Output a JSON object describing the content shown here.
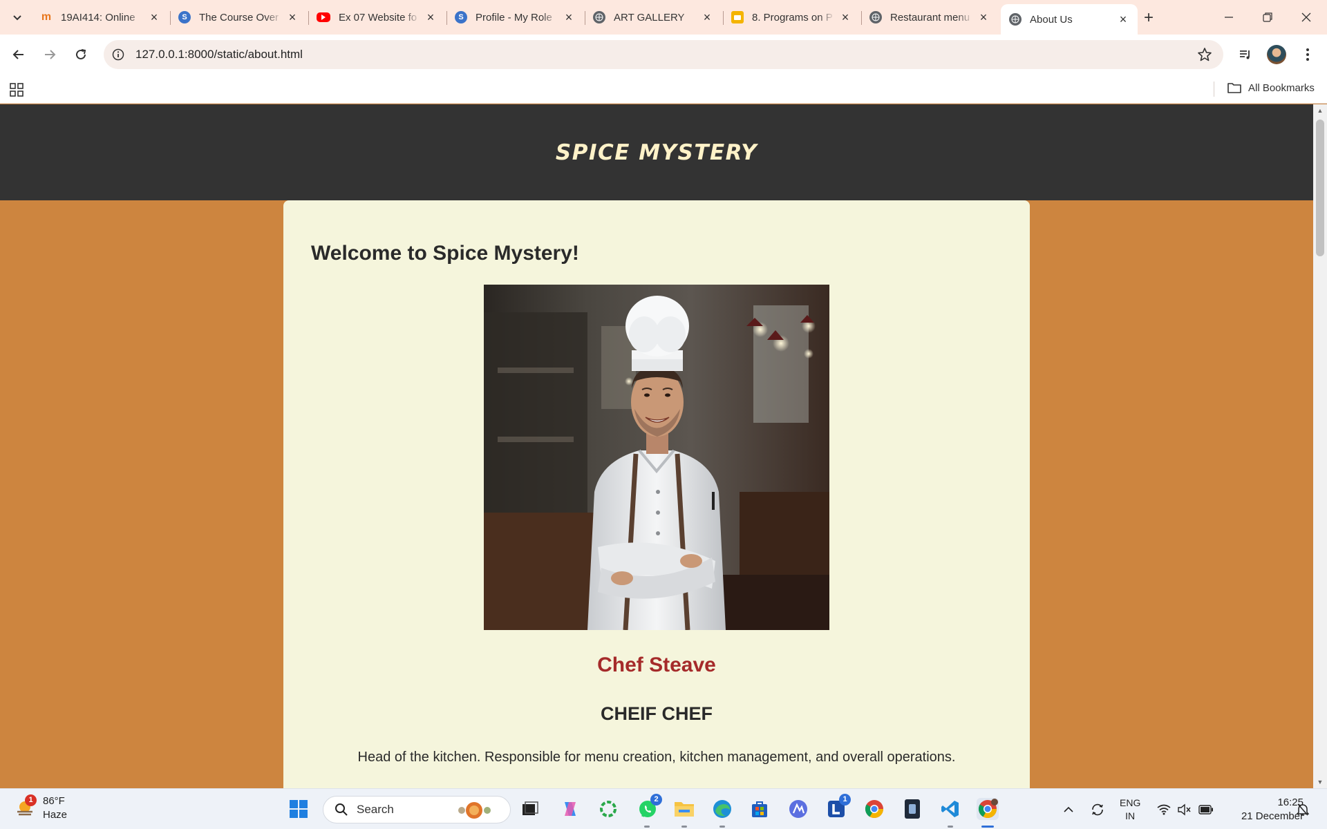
{
  "browser": {
    "tabs": [
      {
        "title": "19AI414: Online",
        "favicon": "moodle-icon",
        "color": "#e8761c",
        "active": false
      },
      {
        "title": "The Course Over",
        "favicon": "globe-icon",
        "color": "#3b73c9",
        "active": false
      },
      {
        "title": "Ex 07 Website fo",
        "favicon": "youtube-icon",
        "color": "#ff0000",
        "active": false
      },
      {
        "title": "Profile - My Role",
        "favicon": "globe-icon",
        "color": "#3b73c9",
        "active": false
      },
      {
        "title": "ART GALLERY",
        "favicon": "globe-icon",
        "color": "#5f6368",
        "active": false
      },
      {
        "title": "8. Programs on P",
        "favicon": "slides-icon",
        "color": "#f4b400",
        "active": false
      },
      {
        "title": "Restaurant menu",
        "favicon": "globe-icon",
        "color": "#5f6368",
        "active": false
      },
      {
        "title": "About Us",
        "favicon": "globe-icon",
        "color": "#5f6368",
        "active": true
      }
    ],
    "url": "127.0.0.1:8000/static/about.html",
    "bookmarks_label": "All Bookmarks"
  },
  "site": {
    "title": "SPICE MYSTERY",
    "welcome": "Welcome to Spice Mystery!",
    "chef": {
      "name": "Chef Steave",
      "role": "CHEIF CHEF",
      "description": "Head of the kitchen. Responsible for menu creation, kitchen management, and overall operations."
    },
    "colors": {
      "header_bg": "#333333",
      "page_bg": "#cd853f",
      "card_bg": "#f5f5dc",
      "chef_name": "#a52a2a"
    }
  },
  "taskbar": {
    "weather": {
      "temp": "86°F",
      "condition": "Haze",
      "badge": "1"
    },
    "search_placeholder": "Search",
    "whatsapp_badge": "2",
    "l_badge": "1",
    "tray": {
      "lang_top": "ENG",
      "lang_bottom": "IN"
    },
    "clock": {
      "time": "16:25",
      "date": "21 December"
    }
  }
}
